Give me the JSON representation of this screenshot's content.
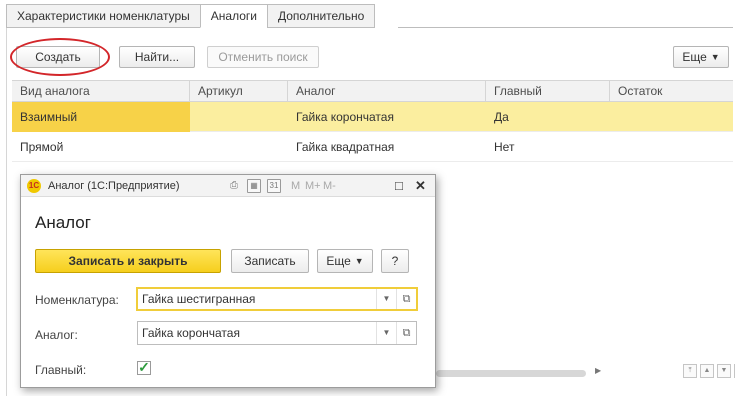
{
  "tabs": [
    {
      "label": "Характеристики номенклатуры"
    },
    {
      "label": "Аналоги"
    },
    {
      "label": "Дополнительно"
    }
  ],
  "toolbar": {
    "create_label": "Создать",
    "find_label": "Найти...",
    "cancel_search_label": "Отменить поиск",
    "more_label": "Еще"
  },
  "table": {
    "columns": [
      "Вид аналога",
      "Артикул",
      "Аналог",
      "Главный",
      "Остаток"
    ],
    "rows": [
      {
        "kind": "Взаимный",
        "article": "",
        "analog": "Гайка корончатая",
        "main": "Да",
        "stock": ""
      },
      {
        "kind": "Прямой",
        "article": "",
        "analog": "Гайка квадратная",
        "main": "Нет",
        "stock": ""
      }
    ]
  },
  "dialog": {
    "window_title": "Аналог (1С:Предприятие)",
    "app_icon": "1С",
    "heading": "Аналог",
    "save_close_label": "Записать и закрыть",
    "save_label": "Записать",
    "more_label": "Еще",
    "help_label": "?",
    "m_labels": [
      "M",
      "M+",
      "M-"
    ],
    "fields": {
      "nomenclature_label": "Номенклатура:",
      "nomenclature_value": "Гайка шестигранная",
      "analog_label": "Аналог:",
      "analog_value": "Гайка корончатая",
      "main_label": "Главный:",
      "main_checked": true
    }
  },
  "colors": {
    "accent_yellow": "#f7d248",
    "selected_row": "#fbee9f",
    "highlight_oval": "#d3262a"
  }
}
